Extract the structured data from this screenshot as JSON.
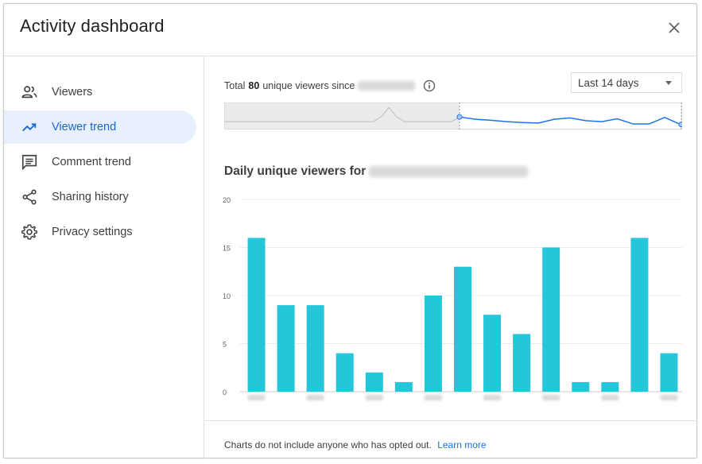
{
  "dialog": {
    "title": "Activity dashboard"
  },
  "sidebar": {
    "items": [
      {
        "label": "Viewers",
        "icon": "people-icon"
      },
      {
        "label": "Viewer trend",
        "icon": "trending-up-icon",
        "active": true
      },
      {
        "label": "Comment trend",
        "icon": "comment-icon"
      },
      {
        "label": "Sharing history",
        "icon": "share-icon"
      },
      {
        "label": "Privacy settings",
        "icon": "gear-icon"
      }
    ]
  },
  "summary": {
    "prefix": "Total",
    "count": "80",
    "suffix": "unique viewers since"
  },
  "range_select": {
    "value": "Last 14 days"
  },
  "chart_heading": "Daily unique viewers for",
  "footer": {
    "text": "Charts do not include anyone who has opted out.",
    "link": "Learn more"
  },
  "colors": {
    "accent": "#1967d2",
    "bar": "#26c6da",
    "active_bg": "#e8f0fe",
    "spark_line": "#1a73e8"
  },
  "chart_data": {
    "type": "bar",
    "categories": [
      "",
      "",
      "",
      "",
      "",
      "",
      "",
      "",
      "",
      "",
      "",
      "",
      "",
      "",
      ""
    ],
    "values": [
      16,
      9,
      9,
      4,
      2,
      1,
      10,
      13,
      8,
      6,
      15,
      1,
      1,
      16,
      4
    ],
    "yticks": [
      0,
      5,
      10,
      15,
      20
    ],
    "ylim": [
      0,
      20
    ],
    "grid": true,
    "title": "",
    "xlabel": "",
    "ylabel": ""
  },
  "sparkline": {
    "past_values": [
      1,
      1,
      1,
      1,
      1,
      1,
      1,
      1,
      1,
      1,
      1,
      1,
      1,
      1,
      1,
      1,
      1,
      1,
      1,
      1,
      2,
      4,
      2,
      1,
      1,
      1,
      1,
      1,
      1,
      1,
      2
    ],
    "recent_values": [
      2,
      1.5,
      1.3,
      1,
      0.8,
      0.7,
      1.5,
      1.8,
      1.2,
      1,
      1.6,
      0.5,
      0.5,
      1.9,
      0.4
    ]
  }
}
